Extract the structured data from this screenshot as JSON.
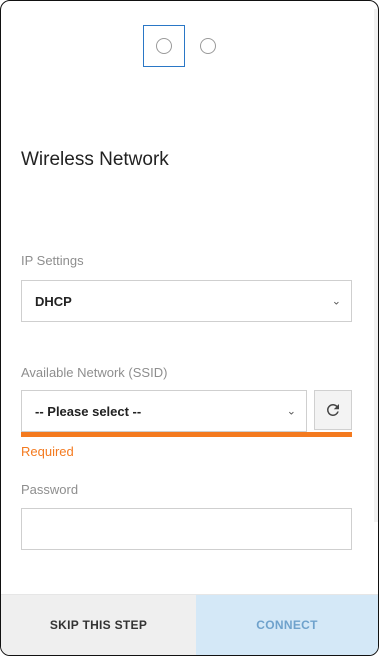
{
  "stepper": {
    "steps": [
      {
        "name": "step-1",
        "active": true
      },
      {
        "name": "step-2",
        "active": false
      }
    ]
  },
  "form": {
    "title": "Wireless Network",
    "ip_settings": {
      "label": "IP Settings",
      "value": "DHCP"
    },
    "ssid": {
      "label": "Available Network (SSID)",
      "value": "-- Please select --",
      "error": "Required"
    },
    "password": {
      "label": "Password",
      "value": ""
    }
  },
  "footer": {
    "skip_label": "SKIP THIS STEP",
    "connect_label": "CONNECT"
  },
  "colors": {
    "accent": "#2a77c6",
    "error": "#f47a1f",
    "connect_bg": "#d4e8f7",
    "connect_text": "#6fa2cc"
  },
  "icons": {
    "chevron": "chevron-down-icon",
    "refresh": "refresh-icon"
  }
}
